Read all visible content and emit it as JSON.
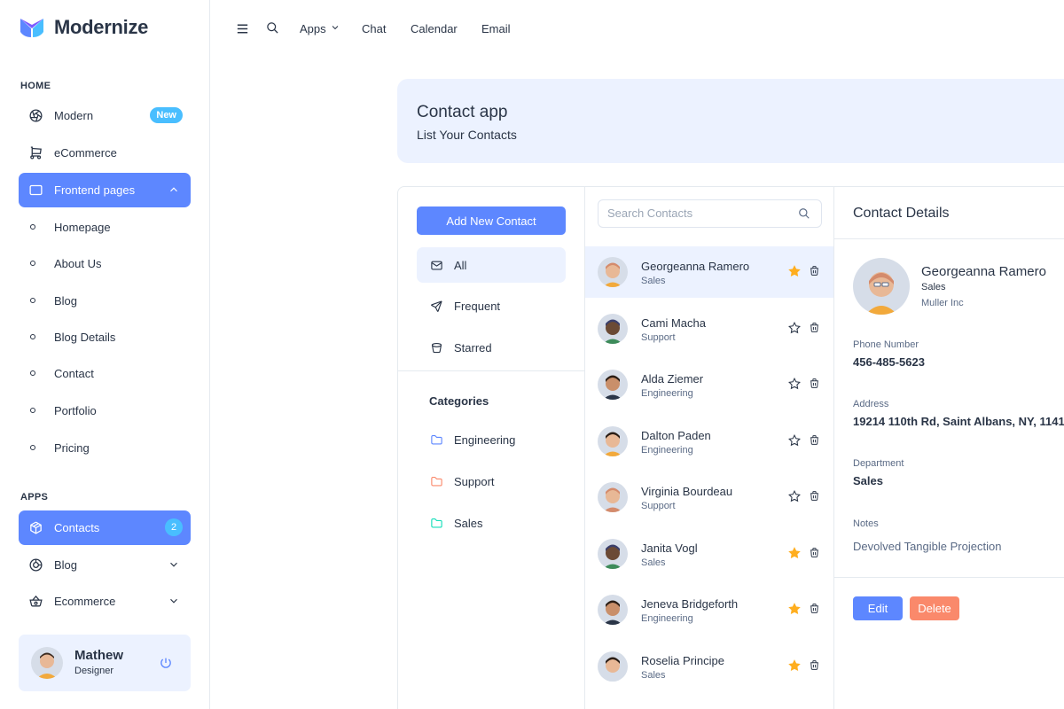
{
  "brand": {
    "name": "Modernize"
  },
  "colors": {
    "primary": "#5d87ff",
    "info": "#49beff",
    "danger": "#fa896b",
    "warning": "#ffae1f",
    "light_primary": "#ecf2ff"
  },
  "sidebar": {
    "home_caption": "HOME",
    "items": [
      {
        "label": "Modern",
        "icon": "aperture-icon",
        "badge": "New"
      },
      {
        "label": "eCommerce",
        "icon": "shopping-cart-icon"
      },
      {
        "label": "Frontend pages",
        "icon": "app-window-icon",
        "active": true
      }
    ],
    "sub_items": [
      "Homepage",
      "About Us",
      "Blog",
      "Blog Details",
      "Contact",
      "Portfolio",
      "Pricing"
    ],
    "apps_caption": "APPS",
    "apps": [
      {
        "label": "Contacts",
        "icon": "package-icon",
        "badge": "2",
        "active": true
      },
      {
        "label": "Blog",
        "icon": "chart-donut-icon"
      },
      {
        "label": "Ecommerce",
        "icon": "basket-icon"
      }
    ],
    "profile": {
      "name": "Mathew",
      "role": "Designer"
    }
  },
  "header": {
    "links": [
      "Apps",
      "Chat",
      "Calendar",
      "Email"
    ]
  },
  "banner": {
    "title": "Contact app",
    "subtitle": "List Your Contacts"
  },
  "filters": {
    "add_button": "Add New Contact",
    "items": [
      "All",
      "Frequent",
      "Starred"
    ],
    "categories_title": "Categories",
    "categories": [
      {
        "label": "Engineering",
        "color": "#5d87ff"
      },
      {
        "label": "Support",
        "color": "#fa896b"
      },
      {
        "label": "Sales",
        "color": "#13deb9"
      }
    ]
  },
  "search": {
    "placeholder": "Search Contacts"
  },
  "contacts": [
    {
      "name": "Georgeanna Ramero",
      "dept": "Sales",
      "starred": true,
      "selected": true
    },
    {
      "name": "Cami Macha",
      "dept": "Support",
      "starred": false
    },
    {
      "name": "Alda Ziemer",
      "dept": "Engineering",
      "starred": false
    },
    {
      "name": "Dalton Paden",
      "dept": "Engineering",
      "starred": false
    },
    {
      "name": "Virginia Bourdeau",
      "dept": "Support",
      "starred": false
    },
    {
      "name": "Janita Vogl",
      "dept": "Sales",
      "starred": true
    },
    {
      "name": "Jeneva Bridgeforth",
      "dept": "Engineering",
      "starred": true
    },
    {
      "name": "Roselia Principe",
      "dept": "Sales",
      "starred": true
    }
  ],
  "details": {
    "title": "Contact Details",
    "name": "Georgeanna Ramero",
    "dept": "Sales",
    "company": "Muller Inc",
    "phone_label": "Phone Number",
    "phone": "456-485-5623",
    "address_label": "Address",
    "address": "19214 110th Rd, Saint Albans, NY, 1141",
    "department_label": "Department",
    "department": "Sales",
    "notes_label": "Notes",
    "notes": "Devolved Tangible Projection",
    "edit_label": "Edit",
    "delete_label": "Delete"
  }
}
